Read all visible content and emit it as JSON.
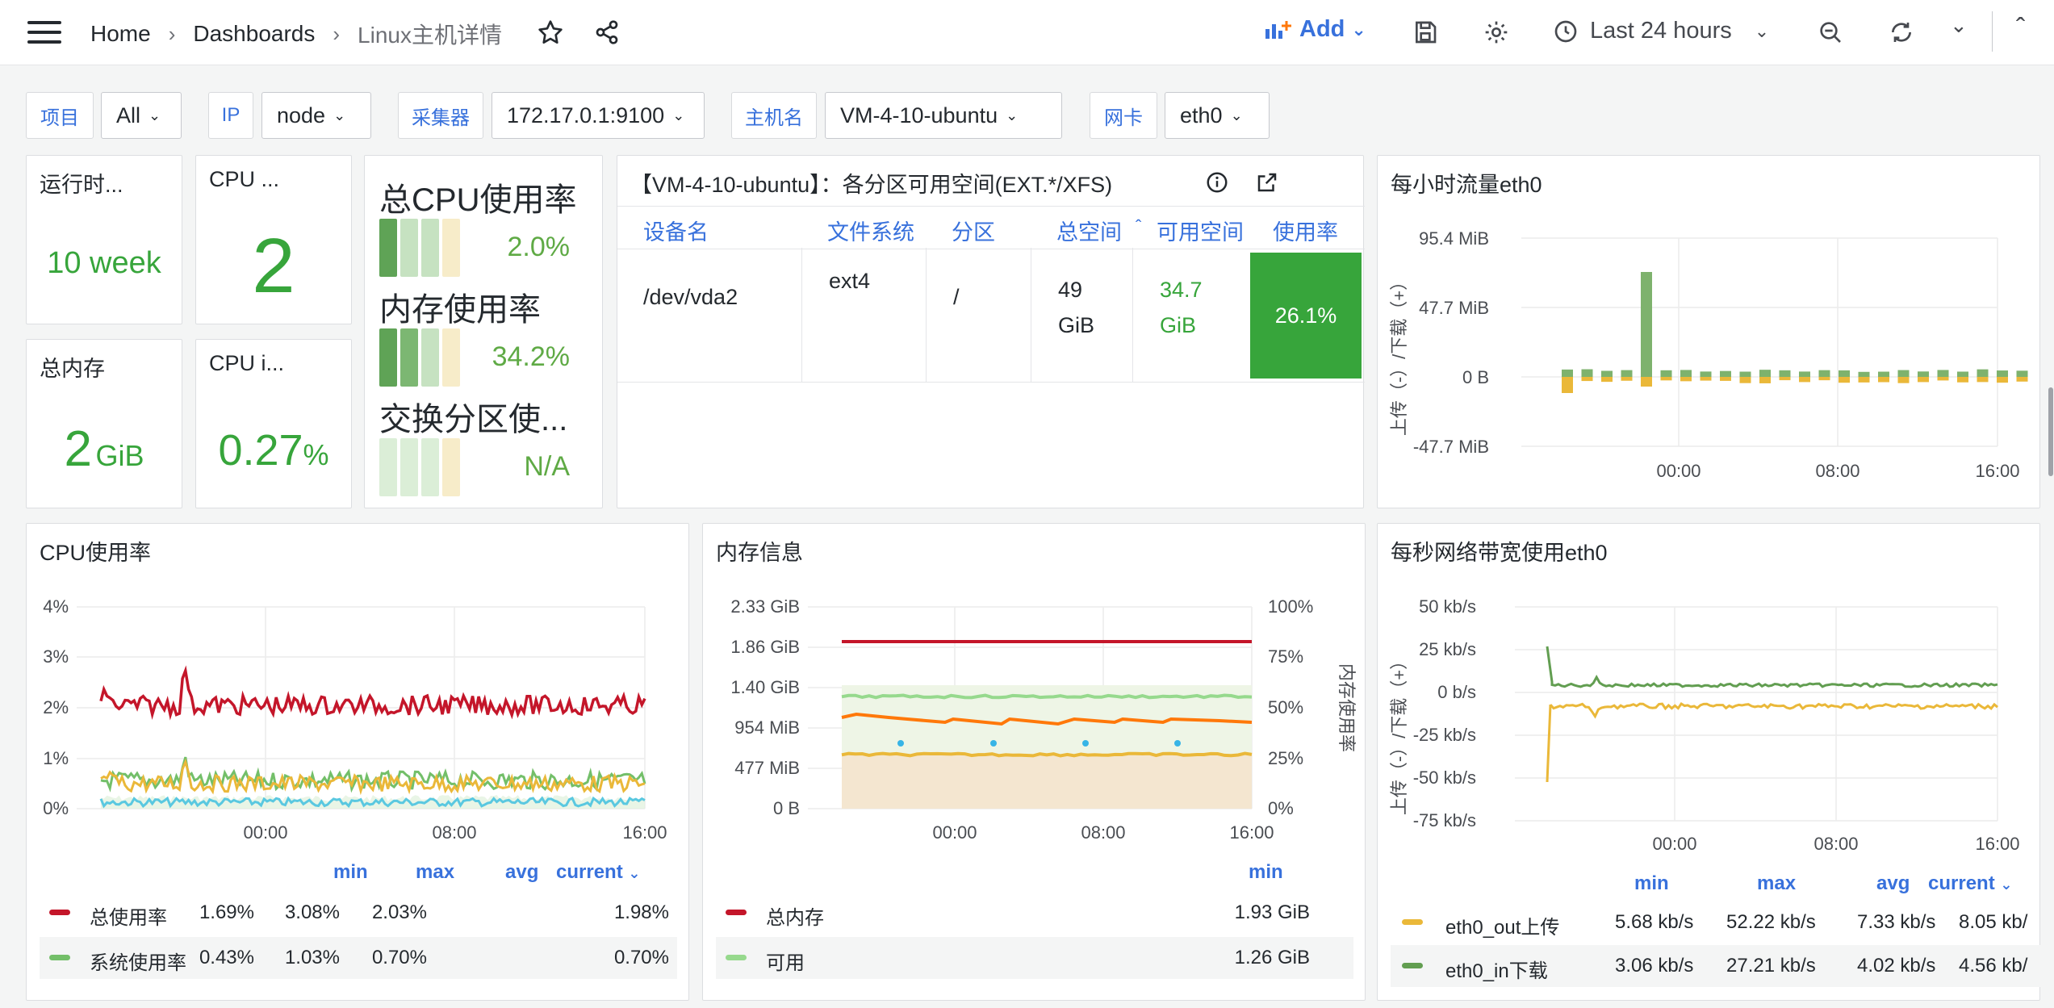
{
  "breadcrumb": {
    "home": "Home",
    "dashboards": "Dashboards",
    "current": "Linux主机详情"
  },
  "toolbar": {
    "add_label": "Add",
    "time_range": "Last 24 hours"
  },
  "variables": [
    {
      "label": "项目",
      "value": "All"
    },
    {
      "label": "IP",
      "value": "node"
    },
    {
      "label": "采集器",
      "value": "172.17.0.1:9100"
    },
    {
      "label": "主机名",
      "value": "VM-4-10-ubuntu"
    },
    {
      "label": "网卡",
      "value": "eth0"
    }
  ],
  "stats": {
    "uptime": {
      "title": "运行时...",
      "value": "10 week"
    },
    "cpu_count": {
      "title": "CPU ...",
      "value": "2"
    },
    "total_mem": {
      "title": "总内存",
      "value": "2",
      "unit": "GiB"
    },
    "cpu_iowait": {
      "title": "CPU i...",
      "value": "0.27",
      "unit": "%"
    }
  },
  "gauges": [
    {
      "label": "总CPU使用率",
      "value": "2.0%",
      "level": 0.02
    },
    {
      "label": "内存使用率",
      "value": "34.2%",
      "level": 0.342
    },
    {
      "label": "交换分区使...",
      "value": "N/A",
      "level": 0
    }
  ],
  "fs_panel": {
    "title": "【VM-4-10-ubuntu】：各分区可用空间(EXT.*/XFS)",
    "columns": [
      "设备名",
      "文件系统",
      "分区",
      "总空间",
      "可用空间",
      "使用率"
    ],
    "rows": [
      {
        "device": "/dev/vda2",
        "fstype": "ext4",
        "mount": "/",
        "total_num": "49",
        "total_unit": "GiB",
        "avail_num": "34.7",
        "avail_unit": "GiB",
        "usage": "26.1%"
      }
    ]
  },
  "traffic_hourly": {
    "title": "每小时流量eth0",
    "ylabel": "上传（-）/下载（+）",
    "y_ticks": [
      "95.4 MiB",
      "47.7 MiB",
      "0 B",
      "-47.7 MiB"
    ],
    "x_ticks": [
      "00:00",
      "08:00",
      "16:00"
    ]
  },
  "cpu_panel": {
    "title": "CPU使用率",
    "y_ticks": [
      "4%",
      "3%",
      "2%",
      "1%",
      "0%"
    ],
    "x_ticks": [
      "00:00",
      "08:00",
      "16:00"
    ],
    "legend_headers": [
      "min",
      "max",
      "avg",
      "current"
    ],
    "legend": [
      {
        "name": "总使用率",
        "color": "#c4162a",
        "min": "1.69%",
        "max": "3.08%",
        "avg": "2.03%",
        "current": "1.98%"
      },
      {
        "name": "系统使用率",
        "color": "#73bf69",
        "min": "0.43%",
        "max": "1.03%",
        "avg": "0.70%",
        "current": "0.70%"
      }
    ]
  },
  "mem_panel": {
    "title": "内存信息",
    "y_ticks": [
      "2.33 GiB",
      "1.86 GiB",
      "1.40 GiB",
      "954 MiB",
      "477 MiB",
      "0 B"
    ],
    "y2_ticks": [
      "100%",
      "75%",
      "50%",
      "25%",
      "0%"
    ],
    "y2_label": "内存使用率",
    "x_ticks": [
      "00:00",
      "08:00",
      "16:00"
    ],
    "legend_header": "min",
    "legend": [
      {
        "name": "总内存",
        "color": "#c4162a",
        "min": "1.93 GiB"
      },
      {
        "name": "可用",
        "color": "#96d98d",
        "min": "1.26 GiB"
      }
    ]
  },
  "bw_panel": {
    "title": "每秒网络带宽使用eth0",
    "ylabel": "上传（-）/下载（+）",
    "y_ticks": [
      "50 kb/s",
      "25 kb/s",
      "0 b/s",
      "-25 kb/s",
      "-50 kb/s",
      "-75 kb/s"
    ],
    "x_ticks": [
      "00:00",
      "08:00",
      "16:00"
    ],
    "legend_headers": [
      "min",
      "max",
      "avg",
      "current"
    ],
    "legend": [
      {
        "name": "eth0_out上传",
        "color": "#eab839",
        "min": "5.68 kb/s",
        "max": "52.22 kb/s",
        "avg": "7.33 kb/s",
        "current": "8.05 kb/"
      },
      {
        "name": "eth0_in下载",
        "color": "#629e51",
        "min": "3.06 kb/s",
        "max": "27.21 kb/s",
        "avg": "4.02 kb/s",
        "current": "4.56 kb/"
      }
    ]
  },
  "colors": {
    "accent": "#3871dc",
    "green": "#37a53b",
    "red": "#c4162a",
    "yellow": "#eab839",
    "orange": "#ff780a",
    "cyan": "#5ac8e0"
  }
}
